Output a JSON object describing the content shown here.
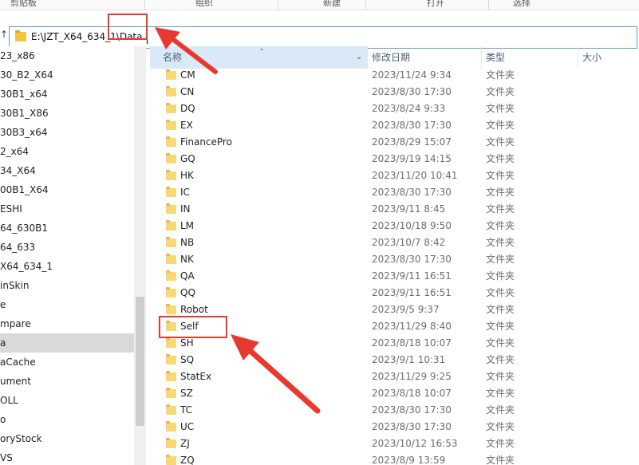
{
  "ribbon": {
    "groups": [
      "剪贴板",
      "组织",
      "新建",
      "打开",
      "选择"
    ]
  },
  "address": {
    "path": "E:\\JZT_X64_634_1\\Data"
  },
  "nav": {
    "items": [
      "23_x86",
      "30_B2_X64",
      "30B1_x64",
      "30B1_X86",
      "30B3_x64",
      "2_x64",
      "34_X64",
      "00B1_X64",
      "ESHI",
      "64_630B1",
      "64_633",
      "X64_634_1",
      "inSkin",
      "e",
      "mpare",
      "a",
      "aCache",
      "ument",
      "OLL",
      "o",
      "oryStock",
      "VS"
    ],
    "selected_index": 15
  },
  "columns": {
    "name": "名称",
    "date": "修改日期",
    "type": "类型",
    "size": "大小"
  },
  "files": [
    {
      "name": "CM",
      "date": "2023/11/24 9:34",
      "type": "文件夹"
    },
    {
      "name": "CN",
      "date": "2023/8/30 17:30",
      "type": "文件夹"
    },
    {
      "name": "DQ",
      "date": "2023/8/24 9:33",
      "type": "文件夹"
    },
    {
      "name": "EX",
      "date": "2023/8/30 17:30",
      "type": "文件夹"
    },
    {
      "name": "FinancePro",
      "date": "2023/8/29 15:07",
      "type": "文件夹"
    },
    {
      "name": "GQ",
      "date": "2023/9/19 14:15",
      "type": "文件夹"
    },
    {
      "name": "HK",
      "date": "2023/11/20 10:41",
      "type": "文件夹"
    },
    {
      "name": "IC",
      "date": "2023/8/30 17:30",
      "type": "文件夹"
    },
    {
      "name": "IN",
      "date": "2023/9/11 8:45",
      "type": "文件夹"
    },
    {
      "name": "LM",
      "date": "2023/10/18 9:50",
      "type": "文件夹"
    },
    {
      "name": "NB",
      "date": "2023/10/7 8:42",
      "type": "文件夹"
    },
    {
      "name": "NK",
      "date": "2023/8/30 17:30",
      "type": "文件夹"
    },
    {
      "name": "QA",
      "date": "2023/9/11 16:51",
      "type": "文件夹"
    },
    {
      "name": "QQ",
      "date": "2023/9/11 16:51",
      "type": "文件夹"
    },
    {
      "name": "Robot",
      "date": "2023/9/5 9:37",
      "type": "文件夹"
    },
    {
      "name": "Self",
      "date": "2023/11/29 8:40",
      "type": "文件夹"
    },
    {
      "name": "SH",
      "date": "2023/8/18 10:07",
      "type": "文件夹"
    },
    {
      "name": "SQ",
      "date": "2023/9/1 10:31",
      "type": "文件夹"
    },
    {
      "name": "StatEx",
      "date": "2023/11/29 9:25",
      "type": "文件夹"
    },
    {
      "name": "SZ",
      "date": "2023/8/18 10:07",
      "type": "文件夹"
    },
    {
      "name": "TC",
      "date": "2023/8/30 17:30",
      "type": "文件夹"
    },
    {
      "name": "UC",
      "date": "2023/8/30 17:30",
      "type": "文件夹"
    },
    {
      "name": "ZJ",
      "date": "2023/10/12 16:53",
      "type": "文件夹"
    },
    {
      "name": "ZQ",
      "date": "2023/8/9 13:59",
      "type": "文件夹"
    }
  ],
  "colors": {
    "annotation": "#e8392f",
    "header_highlight": "#d9e9f8",
    "folder": "#f8d775"
  }
}
